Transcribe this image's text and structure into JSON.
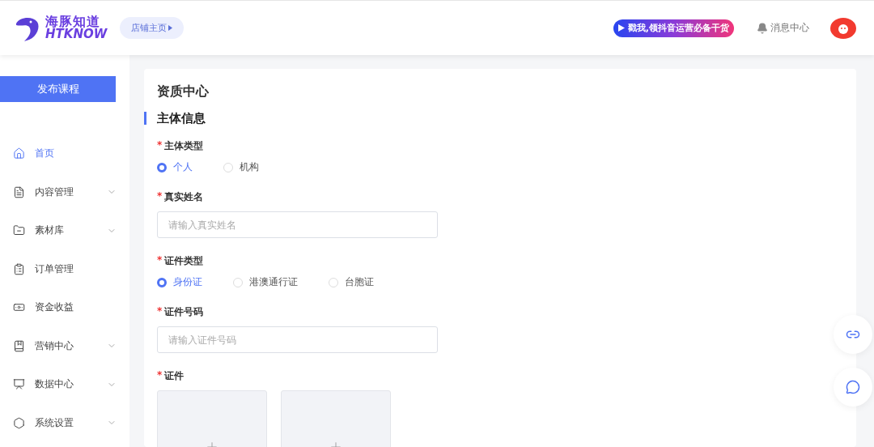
{
  "header": {
    "logo": {
      "name": "海豚知道",
      "latin": "HTKNOW"
    },
    "shop_button": "店铺主页",
    "promo_banner": "戳我,领抖音运营必备干货",
    "messages": "消息中心"
  },
  "sidebar": {
    "publish_button": "发布课程",
    "items": [
      {
        "label": "首页",
        "selected": true,
        "expandable": false
      },
      {
        "label": "内容管理",
        "selected": false,
        "expandable": true
      },
      {
        "label": "素材库",
        "selected": false,
        "expandable": true
      },
      {
        "label": "订单管理",
        "selected": false,
        "expandable": false
      },
      {
        "label": "资金收益",
        "selected": false,
        "expandable": false
      },
      {
        "label": "营销中心",
        "selected": false,
        "expandable": true
      },
      {
        "label": "数据中心",
        "selected": false,
        "expandable": true
      },
      {
        "label": "系统设置",
        "selected": false,
        "expandable": true
      }
    ]
  },
  "page": {
    "title": "资质中心",
    "section_title": "主体信息",
    "fields": [
      {
        "kind": "radio",
        "label": "主体类型",
        "required_mark": "*",
        "options": [
          {
            "label": "个人",
            "selected": true
          },
          {
            "label": "机构",
            "selected": false
          }
        ]
      },
      {
        "kind": "input",
        "label": "真实姓名",
        "required_mark": "*",
        "placeholder": "请输入真实姓名"
      },
      {
        "kind": "radio",
        "label": "证件类型",
        "required_mark": "*",
        "options": [
          {
            "label": "身份证",
            "selected": true
          },
          {
            "label": "港澳通行证",
            "selected": false
          },
          {
            "label": "台胞证",
            "selected": false
          }
        ]
      },
      {
        "kind": "input",
        "label": "证件号码",
        "required_mark": "*",
        "placeholder": "请输入证件号码"
      },
      {
        "kind": "upload",
        "label": "证件",
        "required_mark": "*"
      }
    ]
  }
}
